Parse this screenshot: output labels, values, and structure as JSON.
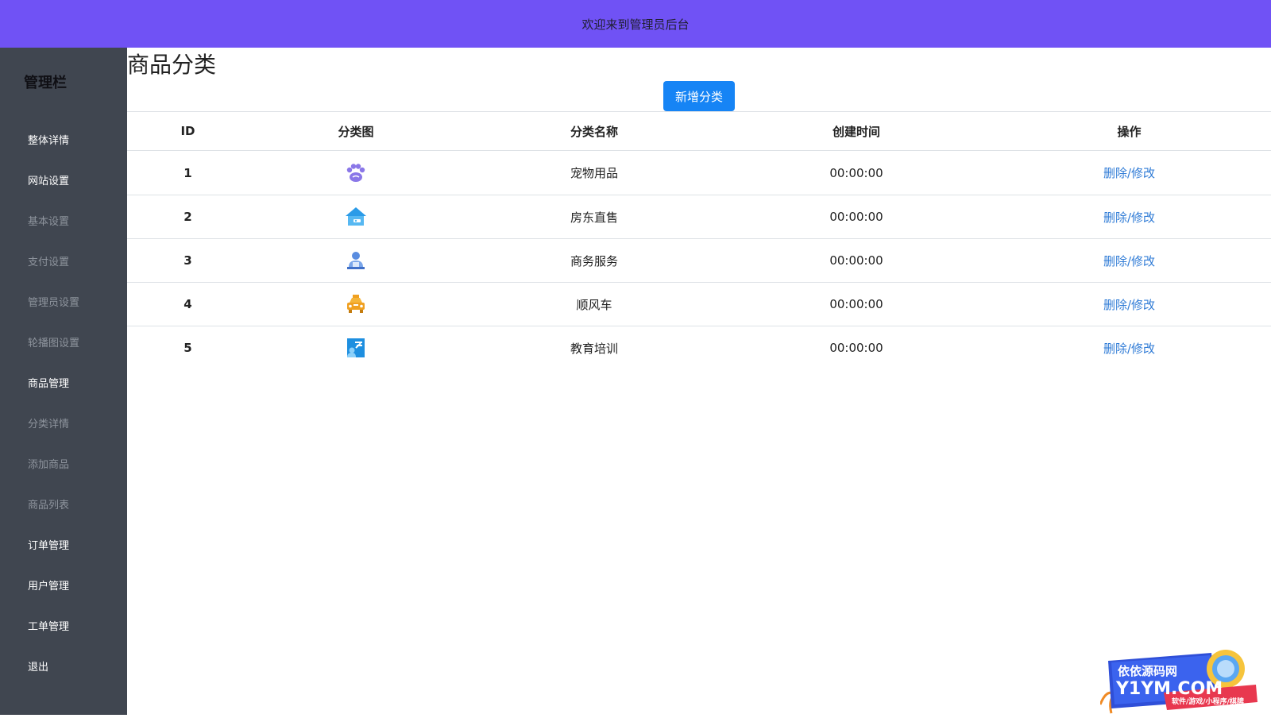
{
  "header": {
    "welcome": "欢迎来到管理员后台"
  },
  "sidebar": {
    "title": "管理栏",
    "items": [
      {
        "label": "整体详情",
        "state": "active"
      },
      {
        "label": "网站设置",
        "state": "active"
      },
      {
        "label": "基本设置",
        "state": "inactive"
      },
      {
        "label": "支付设置",
        "state": "inactive"
      },
      {
        "label": "管理员设置",
        "state": "inactive"
      },
      {
        "label": "轮播图设置",
        "state": "inactive"
      },
      {
        "label": "商品管理",
        "state": "active"
      },
      {
        "label": "分类详情",
        "state": "inactive"
      },
      {
        "label": "添加商品",
        "state": "inactive"
      },
      {
        "label": "商品列表",
        "state": "inactive"
      },
      {
        "label": "订单管理",
        "state": "active"
      },
      {
        "label": "用户管理",
        "state": "active"
      },
      {
        "label": "工单管理",
        "state": "active"
      },
      {
        "label": "退出",
        "state": "active"
      }
    ]
  },
  "main": {
    "title": "商品分类",
    "add_button": "新增分类",
    "columns": [
      "ID",
      "分类图",
      "分类名称",
      "创建时间",
      "操作"
    ],
    "rows": [
      {
        "id": "1",
        "icon": "paw-icon",
        "name": "宠物用品",
        "time": "00:00:00",
        "delete": "删除",
        "sep": "/",
        "edit": "修改"
      },
      {
        "id": "2",
        "icon": "house-icon",
        "name": "房东直售",
        "time": "00:00:00",
        "delete": "删除",
        "sep": "/",
        "edit": "修改"
      },
      {
        "id": "3",
        "icon": "business-person-icon",
        "name": "商务服务",
        "time": "00:00:00",
        "delete": "删除",
        "sep": "/",
        "edit": "修改"
      },
      {
        "id": "4",
        "icon": "taxi-icon",
        "name": "顺风车",
        "time": "00:00:00",
        "delete": "删除",
        "sep": "/",
        "edit": "修改"
      },
      {
        "id": "5",
        "icon": "education-icon",
        "name": "教育培训",
        "time": "00:00:00",
        "delete": "删除",
        "sep": "/",
        "edit": "修改"
      }
    ]
  },
  "watermark": {
    "line1": "依依源码网",
    "line2": "Y1YM.COM",
    "line3": "软件/游戏/小程序/棋牌"
  },
  "colors": {
    "topbar": "#7052f5",
    "sidebar": "#404650",
    "primary_button": "#1684f5",
    "link": "#2f7bd6"
  }
}
